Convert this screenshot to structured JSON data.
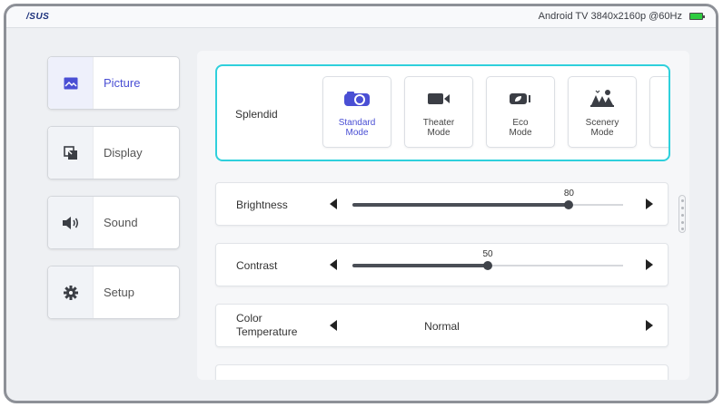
{
  "topbar": {
    "logo": "/SUS",
    "status_text": "Android TV  3840x2160p @60Hz"
  },
  "sidebar": {
    "items": [
      {
        "label": "Picture",
        "icon": "picture-icon",
        "active": true
      },
      {
        "label": "Display",
        "icon": "display-icon",
        "active": false
      },
      {
        "label": "Sound",
        "icon": "sound-icon",
        "active": false
      },
      {
        "label": "Setup",
        "icon": "gear-icon",
        "active": false
      }
    ]
  },
  "modes": {
    "title": "Splendid",
    "items": [
      {
        "label": "Standard\nMode",
        "icon": "projector-icon",
        "active": true
      },
      {
        "label": "Theater\nMode",
        "icon": "camera-icon",
        "active": false
      },
      {
        "label": "Eco\nMode",
        "icon": "eco-icon",
        "active": false
      },
      {
        "label": "Scenery\nMode",
        "icon": "scenery-icon",
        "active": false
      }
    ]
  },
  "settings": {
    "brightness": {
      "label": "Brightness",
      "value": 80,
      "value_text": "80"
    },
    "contrast": {
      "label": "Contrast",
      "value": 50,
      "value_text": "50"
    },
    "color_temperature": {
      "label": "Color\nTemperature",
      "value": "Normal"
    }
  },
  "colors": {
    "accent": "#4a4fd4",
    "focus_border": "#2fd0dc"
  }
}
